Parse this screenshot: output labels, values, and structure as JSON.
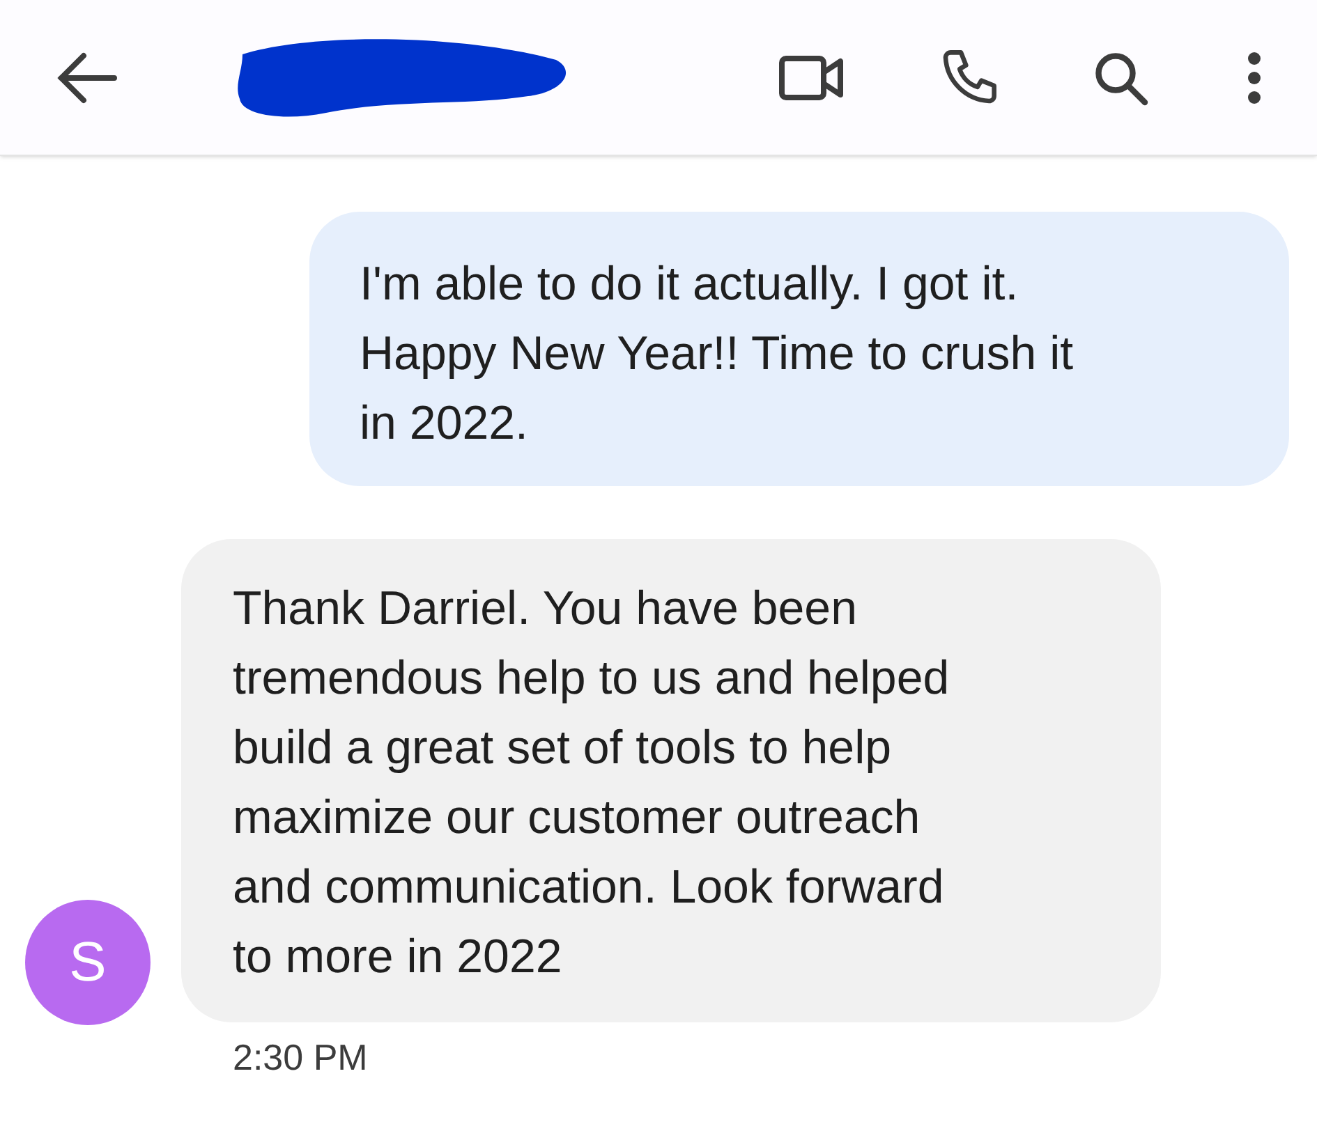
{
  "messages": [
    {
      "kind": "sent",
      "lines": [
        "I'm able to do it actually. I got it.",
        "Happy New Year!! Time to crush it",
        "in 2022."
      ]
    },
    {
      "kind": "received",
      "avatar": "S",
      "lines": [
        "Thank Darriel. You have been",
        "tremendous help to us and helped",
        "build a great set of tools to help",
        "maximize our customer outreach",
        "and communication. Look forward",
        "to more in 2022"
      ],
      "time": "2:30 PM"
    }
  ]
}
